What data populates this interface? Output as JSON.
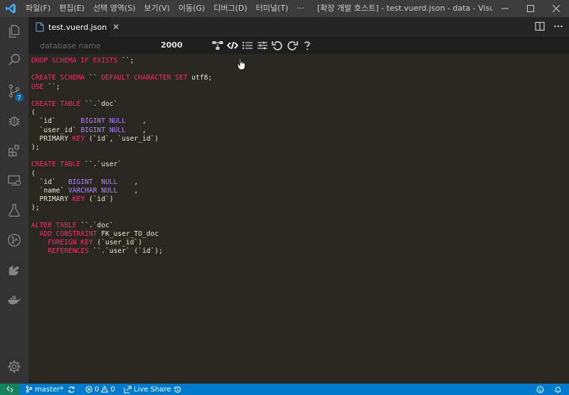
{
  "menu": [
    "파일(F)",
    "편집(E)",
    "선택 영역(S)",
    "보기(V)",
    "이동(G)",
    "디버그(D)",
    "터미널(T)",
    "···"
  ],
  "window_title": "[확장 개발 호스트] - test.vuerd.json - data - Visual Stud...",
  "activity_badge": "7",
  "tab": {
    "label": "test.vuerd.json",
    "close": "✕"
  },
  "tab_actions": [
    "split-editor-icon",
    "more-actions-icon"
  ],
  "toolbar": {
    "db_placeholder": "database name",
    "canvas_size": "2000",
    "tools": [
      "erd-icon",
      "sql-icon",
      "list-icon",
      "settings-icon",
      "undo-icon",
      "redo-icon",
      "help-icon"
    ]
  },
  "code_lines": [
    [
      [
        "DROP SCHEMA IF EXISTS",
        "kw"
      ],
      [
        " ``;",
        ""
      ]
    ],
    [],
    [
      [
        "CREATE SCHEMA",
        "kw"
      ],
      [
        " `` ",
        ""
      ],
      [
        "DEFAULT CHARACTER SET",
        "kw"
      ],
      [
        " utf8;",
        ""
      ]
    ],
    [
      [
        "USE",
        "kw"
      ],
      [
        " ``;",
        ""
      ]
    ],
    [],
    [
      [
        "CREATE TABLE",
        "kw"
      ],
      [
        " ``.`doc`",
        ""
      ]
    ],
    [
      [
        "(",
        ""
      ]
    ],
    [
      [
        "  `id`      ",
        ""
      ],
      [
        "BIGINT",
        "ty"
      ],
      [
        " ",
        ""
      ],
      [
        "NULL",
        "ty"
      ],
      [
        "    ,",
        ""
      ]
    ],
    [
      [
        "  `user_id` ",
        ""
      ],
      [
        "BIGINT",
        "ty"
      ],
      [
        " ",
        ""
      ],
      [
        "NULL",
        "ty"
      ],
      [
        "    ,",
        ""
      ]
    ],
    [
      [
        "  PRIMARY ",
        ""
      ],
      [
        "KEY",
        "kw"
      ],
      [
        " (`id`, `user_id`)",
        ""
      ]
    ],
    [
      [
        ");",
        ""
      ]
    ],
    [],
    [
      [
        "CREATE TABLE",
        "kw"
      ],
      [
        " ``.`user`",
        ""
      ]
    ],
    [
      [
        "(",
        ""
      ]
    ],
    [
      [
        "  `id`   ",
        ""
      ],
      [
        "BIGINT",
        "ty"
      ],
      [
        "  ",
        ""
      ],
      [
        "NULL",
        "ty"
      ],
      [
        "    ,",
        ""
      ]
    ],
    [
      [
        "  `name` ",
        ""
      ],
      [
        "VARCHAR",
        "ty"
      ],
      [
        " ",
        ""
      ],
      [
        "NULL",
        "ty"
      ],
      [
        "    ,",
        ""
      ]
    ],
    [
      [
        "  PRIMARY ",
        ""
      ],
      [
        "KEY",
        "kw"
      ],
      [
        " (`id`)",
        ""
      ]
    ],
    [
      [
        ");",
        ""
      ]
    ],
    [],
    [
      [
        "ALTER TABLE",
        "kw"
      ],
      [
        " ``.`doc`",
        ""
      ]
    ],
    [
      [
        "  ADD CONSTRAINT",
        "kw"
      ],
      [
        " FK_user_TO_doc",
        ""
      ]
    ],
    [
      [
        "    FOREIGN KEY",
        "kw"
      ],
      [
        " (`user_id`)",
        ""
      ]
    ],
    [
      [
        "    REFERENCES",
        "kw"
      ],
      [
        " ``.`user` (`id`);",
        ""
      ]
    ]
  ],
  "status": {
    "branch": "master*",
    "errors": "0",
    "warnings": "0",
    "live_share": "Live Share"
  },
  "colors": {
    "accent": "#007acc",
    "remote": "#16825d",
    "keyword": "#f92672",
    "type": "#ae81ff"
  }
}
